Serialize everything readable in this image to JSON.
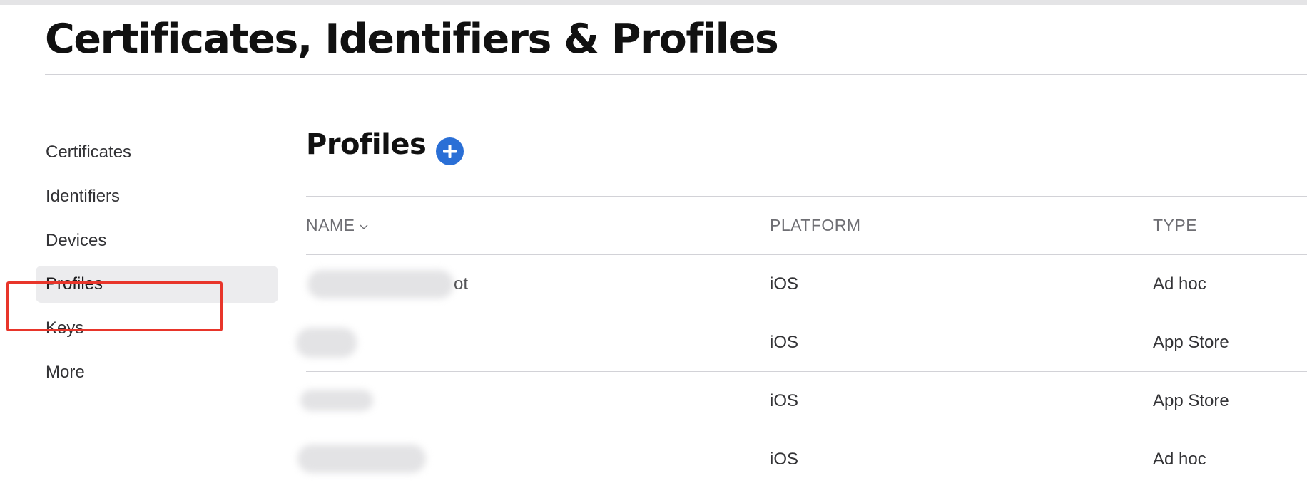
{
  "page": {
    "title": "Certificates, Identifiers & Profiles"
  },
  "sidebar": {
    "items": [
      {
        "label": "Certificates"
      },
      {
        "label": "Identifiers"
      },
      {
        "label": "Devices"
      },
      {
        "label": "Profiles",
        "active": true
      },
      {
        "label": "Keys"
      },
      {
        "label": "More"
      }
    ]
  },
  "main": {
    "section_title": "Profiles",
    "add_icon": "plus-circle-icon",
    "accent_color": "#2a6fd6",
    "highlight_color": "#e8352a",
    "table": {
      "columns": [
        "NAME",
        "PLATFORM",
        "TYPE"
      ],
      "sort_icon": "chevron-down-icon",
      "rows": [
        {
          "name_visible_tail": "ot",
          "platform": "iOS",
          "type": "Ad hoc"
        },
        {
          "name_visible_tail": "",
          "platform": "iOS",
          "type": "App Store"
        },
        {
          "name_visible_tail": "",
          "platform": "iOS",
          "type": "App Store"
        },
        {
          "name_visible_tail": "",
          "platform": "iOS",
          "type": "Ad hoc"
        }
      ]
    }
  }
}
